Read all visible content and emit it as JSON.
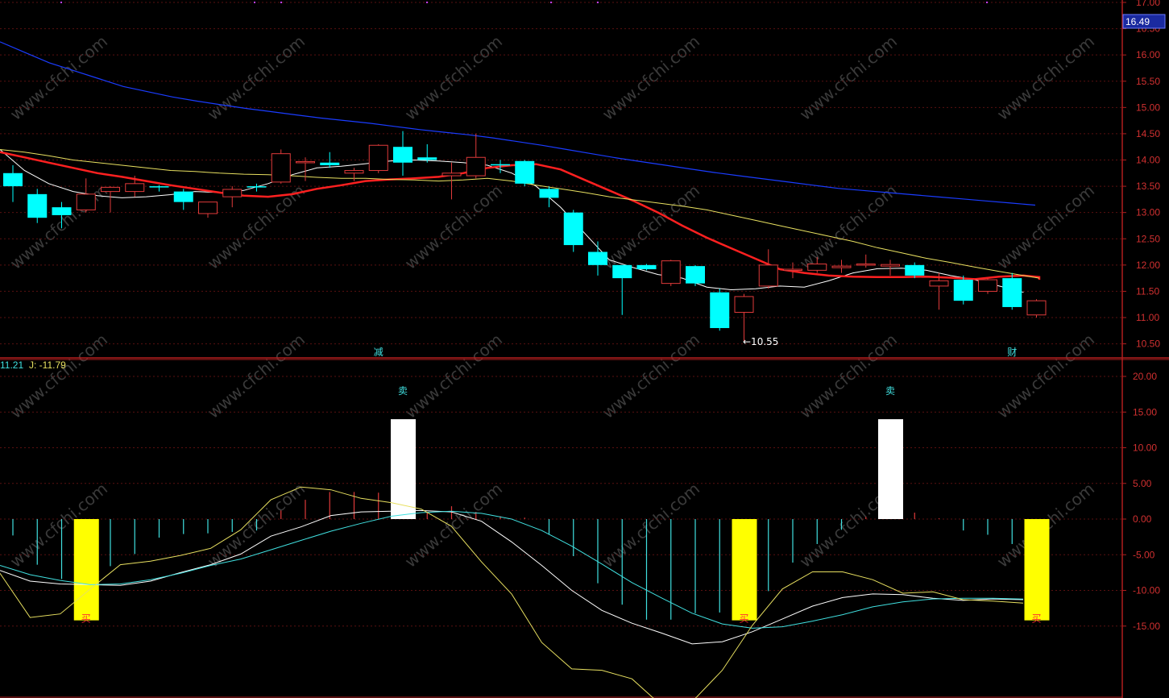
{
  "colors": {
    "background": "#000000",
    "axis": "#b01e1e",
    "grid": "#5a1010",
    "up_candle": "#e03a3a",
    "down_candle": "#00ffff",
    "ma_short": "#ffffff",
    "ma_mid": "#ff2020",
    "ma_long": "#e8e060",
    "ma_longest": "#1a3cff",
    "kdj_k": "#ffffff",
    "kdj_d": "#40e0e0",
    "kdj_j": "#e8e060",
    "buy_bar": "#ffff00",
    "sell_bar": "#ffffff"
  },
  "watermark": "www.cfchi.com",
  "price_panel": {
    "current_price_tag": "16.49",
    "low_marker": "←10.55",
    "event_markers": [
      {
        "text": "减",
        "index": 15
      },
      {
        "text": "财",
        "index": 41
      }
    ]
  },
  "indicator_panel": {
    "legend": [
      {
        "text": "11.21",
        "color": "#40e0e0"
      },
      {
        "text": "J: -11.79",
        "color": "#e8e060"
      }
    ],
    "buy_label": "买",
    "sell_label": "卖"
  },
  "chart_data": [
    {
      "type": "candlestick",
      "ylim": [
        10.4,
        17.0
      ],
      "yticks": [
        "17.00",
        "16.50",
        "16.00",
        "15.50",
        "15.00",
        "14.50",
        "14.00",
        "13.50",
        "13.00",
        "12.50",
        "12.00",
        "11.50",
        "11.00",
        "10.50"
      ],
      "candles": [
        {
          "o": 13.75,
          "h": 13.9,
          "l": 13.2,
          "c": 13.5
        },
        {
          "o": 13.35,
          "h": 13.45,
          "l": 12.8,
          "c": 12.9
        },
        {
          "o": 13.1,
          "h": 13.2,
          "l": 12.7,
          "c": 12.95
        },
        {
          "o": 13.05,
          "h": 13.65,
          "l": 13.0,
          "c": 13.35
        },
        {
          "o": 13.4,
          "h": 13.5,
          "l": 13.0,
          "c": 13.48
        },
        {
          "o": 13.4,
          "h": 13.7,
          "l": 13.3,
          "c": 13.55
        },
        {
          "o": 13.5,
          "h": 13.52,
          "l": 13.4,
          "c": 13.48
        },
        {
          "o": 13.4,
          "h": 13.45,
          "l": 13.05,
          "c": 13.2
        },
        {
          "o": 12.98,
          "h": 13.2,
          "l": 12.9,
          "c": 13.2
        },
        {
          "o": 13.3,
          "h": 13.5,
          "l": 13.1,
          "c": 13.44
        },
        {
          "o": 13.5,
          "h": 13.55,
          "l": 13.4,
          "c": 13.48
        },
        {
          "o": 13.58,
          "h": 14.2,
          "l": 13.55,
          "c": 14.12
        },
        {
          "o": 13.95,
          "h": 14.05,
          "l": 13.6,
          "c": 13.97
        },
        {
          "o": 13.95,
          "h": 14.15,
          "l": 13.85,
          "c": 13.9
        },
        {
          "o": 13.75,
          "h": 13.85,
          "l": 13.6,
          "c": 13.8
        },
        {
          "o": 13.8,
          "h": 14.3,
          "l": 13.75,
          "c": 14.28
        },
        {
          "o": 14.25,
          "h": 14.55,
          "l": 13.7,
          "c": 13.95
        },
        {
          "o": 14.05,
          "h": 14.3,
          "l": 13.95,
          "c": 14.0
        },
        {
          "o": 13.7,
          "h": 13.95,
          "l": 13.25,
          "c": 13.75
        },
        {
          "o": 13.7,
          "h": 14.5,
          "l": 13.65,
          "c": 14.05
        },
        {
          "o": 13.92,
          "h": 14.0,
          "l": 13.75,
          "c": 13.9
        },
        {
          "o": 13.98,
          "h": 14.0,
          "l": 13.5,
          "c": 13.55
        },
        {
          "o": 13.45,
          "h": 13.5,
          "l": 13.1,
          "c": 13.28
        },
        {
          "o": 13.0,
          "h": 13.05,
          "l": 12.25,
          "c": 12.38
        },
        {
          "o": 12.25,
          "h": 12.45,
          "l": 11.8,
          "c": 12.0
        },
        {
          "o": 12.0,
          "h": 12.0,
          "l": 11.05,
          "c": 11.75
        },
        {
          "o": 12.0,
          "h": 12.02,
          "l": 11.9,
          "c": 11.92
        },
        {
          "o": 11.65,
          "h": 12.1,
          "l": 11.6,
          "c": 12.08
        },
        {
          "o": 11.98,
          "h": 12.0,
          "l": 11.6,
          "c": 11.65
        },
        {
          "o": 11.48,
          "h": 11.55,
          "l": 10.75,
          "c": 10.8
        },
        {
          "o": 11.1,
          "h": 11.45,
          "l": 10.55,
          "c": 11.4
        },
        {
          "o": 11.6,
          "h": 12.3,
          "l": 11.55,
          "c": 12.0
        },
        {
          "o": 11.9,
          "h": 12.05,
          "l": 11.75,
          "c": 11.92
        },
        {
          "o": 11.9,
          "h": 12.15,
          "l": 11.85,
          "c": 12.02
        },
        {
          "o": 11.95,
          "h": 12.1,
          "l": 11.85,
          "c": 11.98
        },
        {
          "o": 12.0,
          "h": 12.2,
          "l": 11.95,
          "c": 12.02
        },
        {
          "o": 11.98,
          "h": 12.1,
          "l": 11.8,
          "c": 12.01
        },
        {
          "o": 12.0,
          "h": 12.05,
          "l": 11.75,
          "c": 11.8
        },
        {
          "o": 11.6,
          "h": 11.85,
          "l": 11.15,
          "c": 11.7
        },
        {
          "o": 11.72,
          "h": 11.8,
          "l": 11.25,
          "c": 11.32
        },
        {
          "o": 11.5,
          "h": 11.75,
          "l": 11.45,
          "c": 11.72
        },
        {
          "o": 11.75,
          "h": 11.85,
          "l": 11.15,
          "c": 11.2
        },
        {
          "o": 11.05,
          "h": 11.35,
          "l": 11.0,
          "c": 11.32
        }
      ],
      "series": [
        {
          "values": [
            14.2,
            13.8,
            13.55,
            13.4,
            13.32,
            13.28,
            13.3,
            13.34,
            13.4,
            13.38,
            13.42,
            13.55,
            13.72,
            13.85,
            13.88,
            13.93,
            13.98,
            14.0,
            13.98,
            13.95,
            13.9,
            13.75,
            13.5,
            13.1,
            12.6,
            12.1,
            11.95,
            11.82,
            11.75,
            11.58,
            11.53,
            11.55,
            11.6,
            11.58,
            11.7,
            11.85,
            11.93,
            11.94,
            11.9,
            11.8,
            11.72,
            11.6,
            11.48
          ]
        },
        {
          "values": [
            14.15,
            14.05,
            13.95,
            13.85,
            13.75,
            13.68,
            13.6,
            13.52,
            13.45,
            13.38,
            13.32,
            13.3,
            13.35,
            13.45,
            13.52,
            13.6,
            13.63,
            13.65,
            13.68,
            13.75,
            13.85,
            13.9,
            13.92,
            13.82,
            13.62,
            13.42,
            13.22,
            13.0,
            12.75,
            12.52,
            12.32,
            12.12,
            11.92,
            11.85,
            11.8,
            11.78,
            11.77,
            11.77,
            11.78,
            11.76,
            11.73,
            11.78,
            11.8,
            11.77,
            11.72
          ]
        },
        {
          "values": [
            14.2,
            14.15,
            14.08,
            14.0,
            13.95,
            13.9,
            13.85,
            13.8,
            13.78,
            13.75,
            13.73,
            13.72,
            13.7,
            13.67,
            13.65,
            13.65,
            13.63,
            13.62,
            13.6,
            13.62,
            13.65,
            13.6,
            13.52,
            13.45,
            13.38,
            13.3,
            13.24,
            13.18,
            13.12,
            13.05,
            12.95,
            12.85,
            12.75,
            12.65,
            12.55,
            12.45,
            12.33,
            12.23,
            12.13,
            12.05,
            11.96,
            11.88,
            11.8,
            11.75
          ]
        },
        {
          "values": [
            16.25,
            16.05,
            15.85,
            15.7,
            15.55,
            15.4,
            15.3,
            15.2,
            15.12,
            15.05,
            14.98,
            14.92,
            14.86,
            14.8,
            14.75,
            14.7,
            14.64,
            14.58,
            14.53,
            14.48,
            14.42,
            14.35,
            14.28,
            14.2,
            14.12,
            14.04,
            13.97,
            13.9,
            13.83,
            13.76,
            13.7,
            13.64,
            13.58,
            13.52,
            13.46,
            13.42,
            13.38,
            13.34,
            13.3,
            13.26,
            13.22,
            13.18,
            13.14
          ]
        }
      ]
    },
    {
      "type": "bar",
      "ylim": [
        -21.0,
        23.0
      ],
      "yticks": [
        "20.00",
        "15.00",
        "10.00",
        "5.00",
        "0.00",
        "-5.00",
        "-10.00",
        "-15.00"
      ],
      "categories": [
        0,
        1,
        2,
        3,
        4,
        5,
        6,
        7,
        8,
        9,
        10,
        11,
        12,
        13,
        14,
        15,
        16,
        17,
        18,
        19,
        20,
        21,
        22,
        23,
        24,
        25,
        26,
        27,
        28,
        29,
        30,
        31,
        32,
        33,
        34,
        35,
        36,
        37,
        38,
        39,
        40,
        41,
        42
      ],
      "series": [
        {
          "name": "K",
          "values": [
            -7.2,
            -8.7,
            -9.1,
            -9.2,
            -9.3,
            -8.7,
            -7.5,
            -6.4,
            -4.9,
            -2.4,
            -1.1,
            0.5,
            1.0,
            1.1,
            1.2,
            1.0,
            -0.3,
            -3.2,
            -6.5,
            -10.0,
            -12.8,
            -14.6,
            -16.0,
            -17.5,
            -17.2,
            -15.8,
            -14.0,
            -12.2,
            -11.0,
            -10.5,
            -10.6,
            -11.1,
            -11.4,
            -11.2,
            -11.3
          ]
        },
        {
          "name": "D",
          "values": [
            -6.5,
            -7.8,
            -8.6,
            -9.2,
            -9.1,
            -8.5,
            -7.6,
            -6.5,
            -5.6,
            -4.3,
            -3.0,
            -1.7,
            -0.6,
            0.4,
            0.9,
            1.1,
            0.8,
            0.0,
            -1.6,
            -3.8,
            -6.3,
            -8.9,
            -11.1,
            -13.2,
            -14.7,
            -15.3,
            -15.1,
            -14.3,
            -13.4,
            -12.3,
            -11.6,
            -11.2,
            -11.1,
            -11.1,
            -11.21
          ]
        },
        {
          "name": "J",
          "values": [
            -7.6,
            -13.8,
            -13.3,
            -9.8,
            -6.4,
            -5.9,
            -5.1,
            -4.1,
            -1.5,
            2.7,
            4.5,
            4.1,
            2.9,
            2.3,
            1.4,
            -1.0,
            -6.0,
            -10.5,
            -17.3,
            -21.0,
            -21.2,
            -22.4,
            -26.2,
            -25.6,
            -21.2,
            -14.9,
            -9.8,
            -7.4,
            -7.4,
            -8.5,
            -10.4,
            -10.2,
            -11.3,
            -11.5,
            -11.79
          ]
        }
      ],
      "bars": [
        {
          "i": 0,
          "v": -2.3
        },
        {
          "i": 1,
          "v": -6.4
        },
        {
          "i": 2,
          "v": -8.4
        },
        {
          "i": 4,
          "v": -6.6
        },
        {
          "i": 5,
          "v": -4.9
        },
        {
          "i": 6,
          "v": -2.6
        },
        {
          "i": 7,
          "v": -2.1
        },
        {
          "i": 8,
          "v": -2.0
        },
        {
          "i": 9,
          "v": -1.8
        },
        {
          "i": 10,
          "v": -1.6
        },
        {
          "i": 11,
          "v": 1.2
        },
        {
          "i": 12,
          "v": 2.7
        },
        {
          "i": 13,
          "v": 3.8
        },
        {
          "i": 14,
          "v": 3.8
        },
        {
          "i": 15,
          "v": 3.7
        },
        {
          "i": 17,
          "v": 0.9
        },
        {
          "i": 18,
          "v": 1.8
        },
        {
          "i": 19,
          "v": 1.0
        },
        {
          "i": 20,
          "v": 0.4
        },
        {
          "i": 21,
          "v": 0.2
        },
        {
          "i": 22,
          "v": -2.2
        },
        {
          "i": 23,
          "v": -5.2
        },
        {
          "i": 24,
          "v": -9.0
        },
        {
          "i": 25,
          "v": -12.0
        },
        {
          "i": 26,
          "v": -14.1
        },
        {
          "i": 27,
          "v": -14.1
        },
        {
          "i": 28,
          "v": -13.2
        },
        {
          "i": 29,
          "v": -13.1
        },
        {
          "i": 31,
          "v": -10.1
        },
        {
          "i": 32,
          "v": -6.1
        },
        {
          "i": 33,
          "v": -3.5
        },
        {
          "i": 34,
          "v": -1.5
        },
        {
          "i": 35,
          "v": 0.3
        },
        {
          "i": 37,
          "v": 0.9
        },
        {
          "i": 38,
          "v": 0.1
        },
        {
          "i": 39,
          "v": -1.6
        },
        {
          "i": 40,
          "v": -2.2
        },
        {
          "i": 41,
          "v": -3.5
        }
      ],
      "signals": [
        {
          "type": "buy",
          "i": 3,
          "top": 0.0,
          "bottom": -14.2
        },
        {
          "type": "sell",
          "i": 16,
          "top": 14.0,
          "bottom": 0.0
        },
        {
          "type": "buy",
          "i": 30,
          "top": 0.0,
          "bottom": -14.2
        },
        {
          "type": "sell",
          "i": 36,
          "top": 14.0,
          "bottom": 0.0
        },
        {
          "type": "buy",
          "i": 42,
          "top": 0.0,
          "bottom": -14.2
        }
      ]
    }
  ]
}
